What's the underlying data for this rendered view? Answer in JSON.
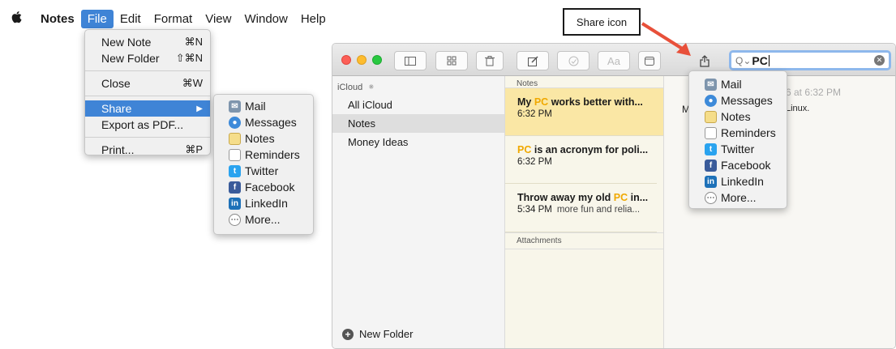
{
  "menubar": {
    "apple": "",
    "app_name": "Notes",
    "items": [
      "File",
      "Edit",
      "Format",
      "View",
      "Window",
      "Help"
    ]
  },
  "file_menu": {
    "new_note": "New Note",
    "new_note_sc": "⌘N",
    "new_folder": "New Folder",
    "new_folder_sc": "⇧⌘N",
    "close": "Close",
    "close_sc": "⌘W",
    "share": "Share",
    "share_arrow": "▶",
    "export_pdf": "Export as PDF...",
    "print": "Print...",
    "print_sc": "⌘P"
  },
  "share_menu": [
    {
      "label": "Mail",
      "icon": "mail-icon"
    },
    {
      "label": "Messages",
      "icon": "messages-icon"
    },
    {
      "label": "Notes",
      "icon": "notes-icon"
    },
    {
      "label": "Reminders",
      "icon": "reminders-icon"
    },
    {
      "label": "Twitter",
      "icon": "twitter-icon"
    },
    {
      "label": "Facebook",
      "icon": "facebook-icon"
    },
    {
      "label": "LinkedIn",
      "icon": "linkedin-icon"
    },
    {
      "label": "More...",
      "icon": "more-icon"
    }
  ],
  "callout": {
    "label": "Share icon"
  },
  "search": {
    "value": "PC",
    "prefix": "Q⌄"
  },
  "sidebar": {
    "header": "iCloud",
    "items": [
      "All iCloud",
      "Notes",
      "Money Ideas"
    ],
    "selected": "Notes",
    "new_folder": "New Folder"
  },
  "notelist": {
    "section": "Notes",
    "notes": [
      {
        "pre": "My ",
        "hl": "PC",
        "post": " works better with...",
        "time": "6:32 PM",
        "preview": ""
      },
      {
        "pre": "",
        "hl": "PC",
        "post": " is an acronym for poli...",
        "time": "6:32 PM",
        "preview": ""
      },
      {
        "pre": "Throw away my old ",
        "hl": "PC",
        "post": " in...",
        "time": "5:34 PM",
        "preview": "more fun and relia..."
      }
    ],
    "attachments": "Attachments"
  },
  "editor": {
    "date_fragment": "6 at 6:32 PM",
    "initial_fragment": "M",
    "text_fragment": "Linux."
  },
  "colors": {
    "menu_highlight": "#3f84d6",
    "note_selected": "#fae7a5",
    "search_highlight": "#f0a800",
    "arrow": "#e8503a"
  }
}
